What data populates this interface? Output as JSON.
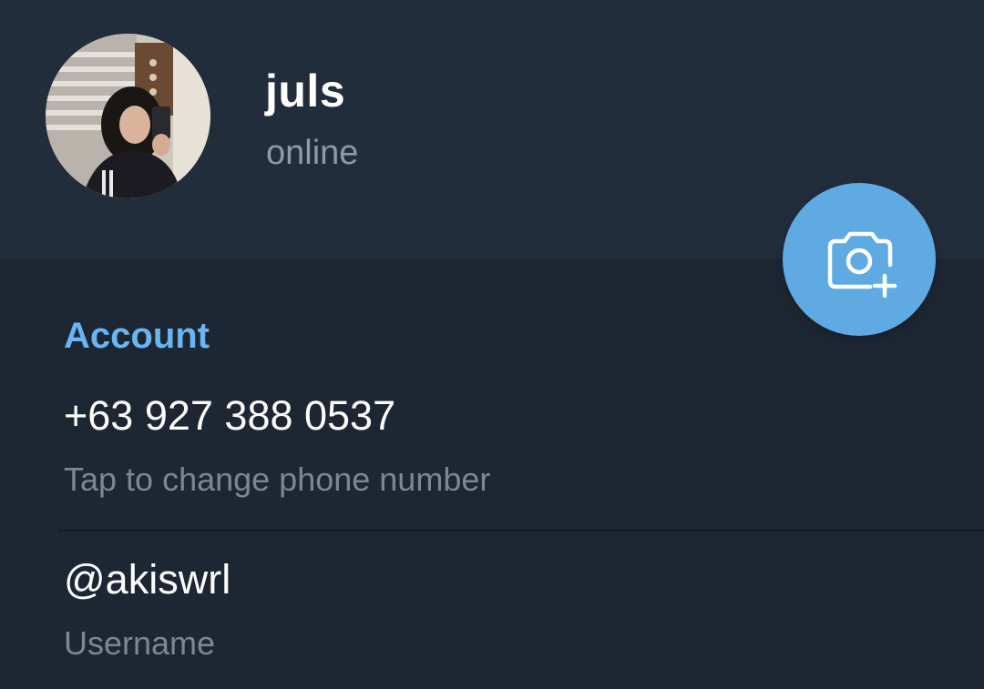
{
  "profile": {
    "name": "juls",
    "status": "online"
  },
  "fab": {
    "icon": "camera-add-icon"
  },
  "account": {
    "section_title": "Account",
    "phone": {
      "value": "+63 927 388 0537",
      "hint": "Tap to change phone number"
    },
    "username": {
      "value": "@akiswrl",
      "hint": "Username"
    }
  },
  "colors": {
    "header_bg": "#222d3c",
    "body_bg": "#1d2733",
    "accent": "#6ab4f0",
    "fab_bg": "#5faae3",
    "secondary_text": "#7b8794"
  }
}
